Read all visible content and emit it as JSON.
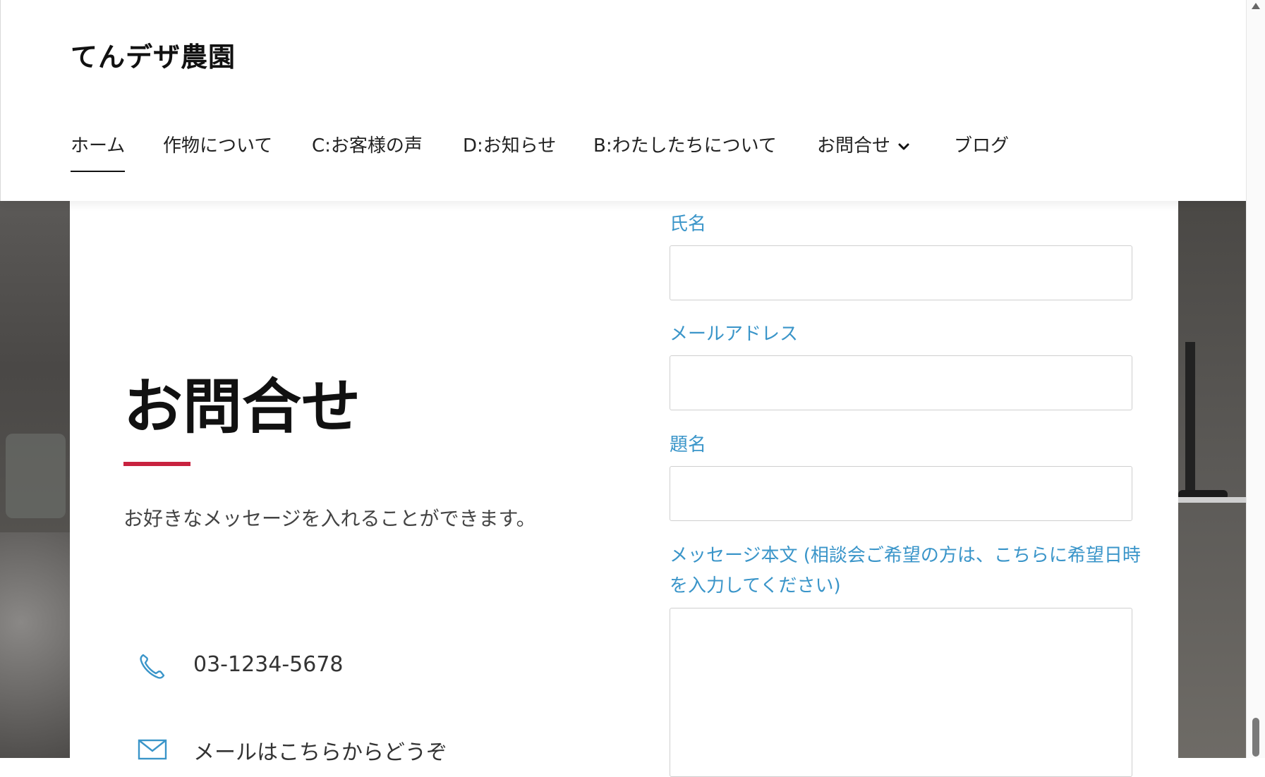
{
  "site": {
    "title": "てんデザ農園"
  },
  "nav": {
    "items": [
      {
        "label": "ホーム",
        "active": true
      },
      {
        "label": "作物について"
      },
      {
        "label": "C:お客様の声"
      },
      {
        "label": "D:お知らせ"
      },
      {
        "label": "B:わたしたちについて"
      },
      {
        "label": "お問合せ",
        "has_dropdown": true
      },
      {
        "label": "ブログ"
      }
    ]
  },
  "contact": {
    "title": "お問合せ",
    "intro": "お好きなメッセージを入れることができます。",
    "phone": "03-1234-5678",
    "mail_text": "メールはこちらからどうぞ"
  },
  "form": {
    "name_label": "氏名",
    "email_label": "メールアドレス",
    "subject_label": "題名",
    "message_label": "メッセージ本文 (相談会ご希望の方は、こちらに希望日時を入力してください)",
    "name_value": "",
    "email_value": "",
    "subject_value": ""
  },
  "colors": {
    "accent": "#c8223f",
    "label_blue": "#3a95c9"
  },
  "icons": {
    "phone": "phone-icon",
    "mail": "mail-icon",
    "dropdown": "chevron-down-icon"
  }
}
